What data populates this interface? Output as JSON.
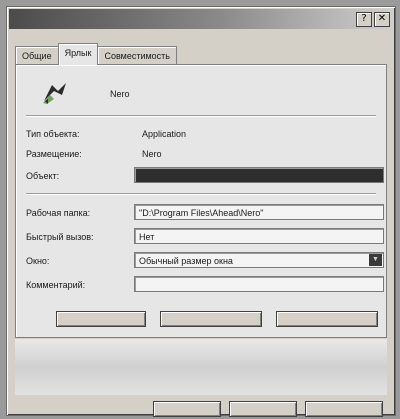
{
  "window": {
    "title_buttons": [
      {
        "icon": "help-icon",
        "glyph": "?"
      },
      {
        "icon": "close-icon",
        "glyph": "✕"
      }
    ]
  },
  "tabs": [
    "Общие",
    "Ярлык",
    "Совместимость"
  ],
  "shortcut": {
    "name": "Nero",
    "rows": [
      {
        "label": "Тип объекта:",
        "value": "Application"
      },
      {
        "label": "Размещение:",
        "value": "Nero"
      }
    ],
    "object_label": "Объект:",
    "object_value": "",
    "workdir_label": "Рабочая папка:",
    "workdir_value": "\"D:\\Program Files\\Ahead\\Nero\"",
    "hotkey_label": "Быстрый вызов:",
    "hotkey_value": "Нет",
    "window_label": "Окно:",
    "window_value": "Обычный размер окна",
    "comment_label": "Комментарий:",
    "comment_value": ""
  },
  "colors": {
    "icon_primary": "#2b2b2b",
    "icon_accent": "#6fa35a"
  }
}
